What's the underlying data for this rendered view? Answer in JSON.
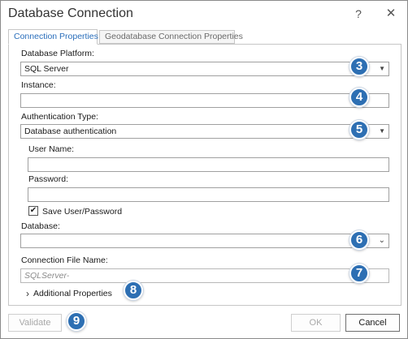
{
  "window": {
    "title": "Database Connection",
    "help_label": "?",
    "close_label": "✕"
  },
  "tabs": [
    {
      "label": "Connection Properties",
      "active": true
    },
    {
      "label": "Geodatabase Connection Properties",
      "active": false
    }
  ],
  "form": {
    "platform": {
      "label": "Database Platform:",
      "value": "SQL Server"
    },
    "instance": {
      "label": "Instance:",
      "value": ""
    },
    "auth": {
      "label": "Authentication Type:",
      "value": "Database authentication"
    },
    "username": {
      "label": "User Name:",
      "value": ""
    },
    "password": {
      "label": "Password:",
      "value": ""
    },
    "save_credentials": {
      "label": "Save User/Password",
      "checked": true
    },
    "database": {
      "label": "Database:",
      "value": ""
    },
    "file_name": {
      "label": "Connection File Name:",
      "placeholder": "SQLServer-"
    },
    "additional": {
      "label": "Additional Properties",
      "expander": "›"
    }
  },
  "buttons": {
    "validate": "Validate",
    "ok": "OK",
    "cancel": "Cancel"
  },
  "callouts": {
    "c3": "3",
    "c4": "4",
    "c5": "5",
    "c6": "6",
    "c7": "7",
    "c8": "8",
    "c9": "9"
  },
  "colors": {
    "accent_tab": "#2a6ebb",
    "badge": "#2d6fb3"
  }
}
